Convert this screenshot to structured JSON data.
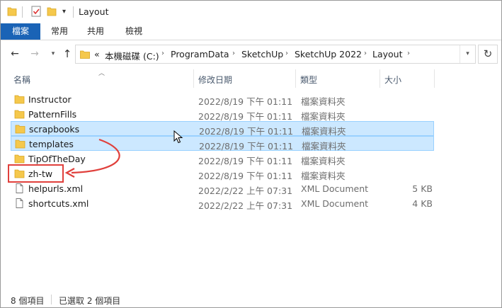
{
  "window": {
    "title": "Layout"
  },
  "ribbon": {
    "tabs": [
      {
        "label": "檔案",
        "active": true
      },
      {
        "label": "常用"
      },
      {
        "label": "共用"
      },
      {
        "label": "檢視"
      }
    ]
  },
  "address": {
    "prefix": "«",
    "segments": [
      "本機磁碟 (C:)",
      "ProgramData",
      "SketchUp",
      "SketchUp 2022",
      "Layout"
    ]
  },
  "columns": {
    "name": "名稱",
    "date": "修改日期",
    "type": "類型",
    "size": "大小"
  },
  "files": [
    {
      "name": "Instructor",
      "date": "2022/8/19 下午 01:11",
      "type": "檔案資料夾",
      "size": "",
      "icon": "folder-icon",
      "selected": false
    },
    {
      "name": "PatternFills",
      "date": "2022/8/19 下午 01:11",
      "type": "檔案資料夾",
      "size": "",
      "icon": "folder-icon",
      "selected": false
    },
    {
      "name": "scrapbooks",
      "date": "2022/8/19 下午 01:11",
      "type": "檔案資料夾",
      "size": "",
      "icon": "folder-icon",
      "selected": true
    },
    {
      "name": "templates",
      "date": "2022/8/19 下午 01:11",
      "type": "檔案資料夾",
      "size": "",
      "icon": "folder-icon",
      "selected": true
    },
    {
      "name": "TipOfTheDay",
      "date": "2022/8/19 下午 01:11",
      "type": "檔案資料夾",
      "size": "",
      "icon": "folder-icon",
      "selected": false
    },
    {
      "name": "zh-tw",
      "date": "2022/8/19 下午 01:11",
      "type": "檔案資料夾",
      "size": "",
      "icon": "folder-icon",
      "selected": false
    },
    {
      "name": "helpurls.xml",
      "date": "2022/2/22 上午 07:31",
      "type": "XML Document",
      "size": "5 KB",
      "icon": "document-icon",
      "selected": false
    },
    {
      "name": "shortcuts.xml",
      "date": "2022/2/22 上午 07:31",
      "type": "XML Document",
      "size": "4 KB",
      "icon": "document-icon",
      "selected": false
    }
  ],
  "status": {
    "item_count": "8 個項目",
    "selected_count": "已選取 2 個項目"
  },
  "colors": {
    "accent": "#1a63b6",
    "selection_fill": "#cce8ff",
    "selection_border": "#99d1ff",
    "annotation": "#e0403c",
    "folder": "#f5c84c"
  }
}
